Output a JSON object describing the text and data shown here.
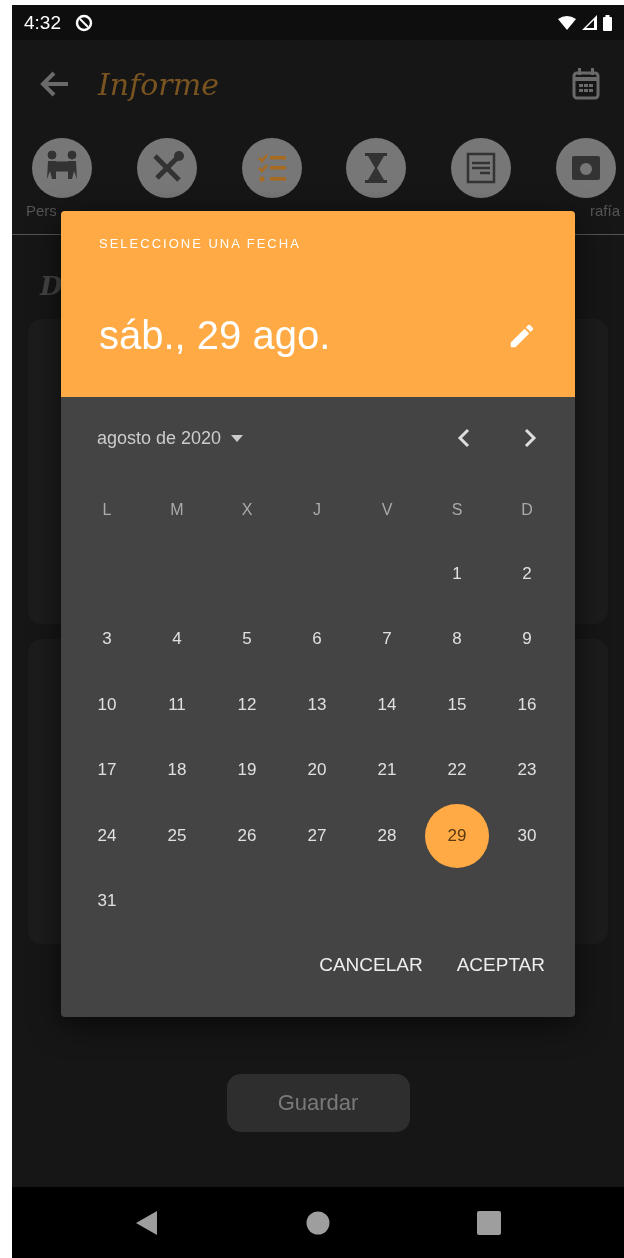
{
  "status_bar": {
    "time": "4:32"
  },
  "app_bar": {
    "title": "Informe"
  },
  "tabs": [
    {
      "label": "Pers",
      "selected": false
    },
    {
      "selected": false
    },
    {
      "selected": true
    },
    {
      "selected": false
    },
    {
      "selected": false
    },
    {
      "label": "rafía",
      "selected": false
    }
  ],
  "section_heading": "D",
  "save_button": {
    "label": "Guardar",
    "disabled": true
  },
  "date_picker": {
    "header_label": "SELECCIONE UNA FECHA",
    "selected_date": "sáb., 29 ago.",
    "month_label": "agosto de 2020",
    "weekdays": [
      "L",
      "M",
      "X",
      "J",
      "V",
      "S",
      "D"
    ],
    "weeks": [
      {
        "kind": "lead",
        "days": [
          {
            "label": "1",
            "selected": false
          },
          {
            "label": "2",
            "selected": false
          }
        ]
      },
      {
        "kind": "full",
        "days": [
          {
            "label": "3",
            "selected": false
          },
          {
            "label": "4",
            "selected": false
          },
          {
            "label": "5",
            "selected": false
          },
          {
            "label": "6",
            "selected": false
          },
          {
            "label": "7",
            "selected": false
          },
          {
            "label": "8",
            "selected": false
          },
          {
            "label": "9",
            "selected": false
          }
        ]
      },
      {
        "kind": "full",
        "days": [
          {
            "label": "10",
            "selected": false
          },
          {
            "label": "11",
            "selected": false
          },
          {
            "label": "12",
            "selected": false
          },
          {
            "label": "13",
            "selected": false
          },
          {
            "label": "14",
            "selected": false
          },
          {
            "label": "15",
            "selected": false
          },
          {
            "label": "16",
            "selected": false
          }
        ]
      },
      {
        "kind": "full",
        "days": [
          {
            "label": "17",
            "selected": false
          },
          {
            "label": "18",
            "selected": false
          },
          {
            "label": "19",
            "selected": false
          },
          {
            "label": "20",
            "selected": false
          },
          {
            "label": "21",
            "selected": false
          },
          {
            "label": "22",
            "selected": false
          },
          {
            "label": "23",
            "selected": false
          }
        ]
      },
      {
        "kind": "full",
        "days": [
          {
            "label": "24",
            "selected": false
          },
          {
            "label": "25",
            "selected": false
          },
          {
            "label": "26",
            "selected": false
          },
          {
            "label": "27",
            "selected": false
          },
          {
            "label": "28",
            "selected": false
          },
          {
            "label": "29",
            "selected": true
          },
          {
            "label": "30",
            "selected": false
          }
        ]
      },
      {
        "kind": "full",
        "days": [
          {
            "label": "31",
            "selected": false
          }
        ]
      }
    ],
    "buttons": [
      "CANCELAR",
      "ACEPTAR"
    ]
  }
}
